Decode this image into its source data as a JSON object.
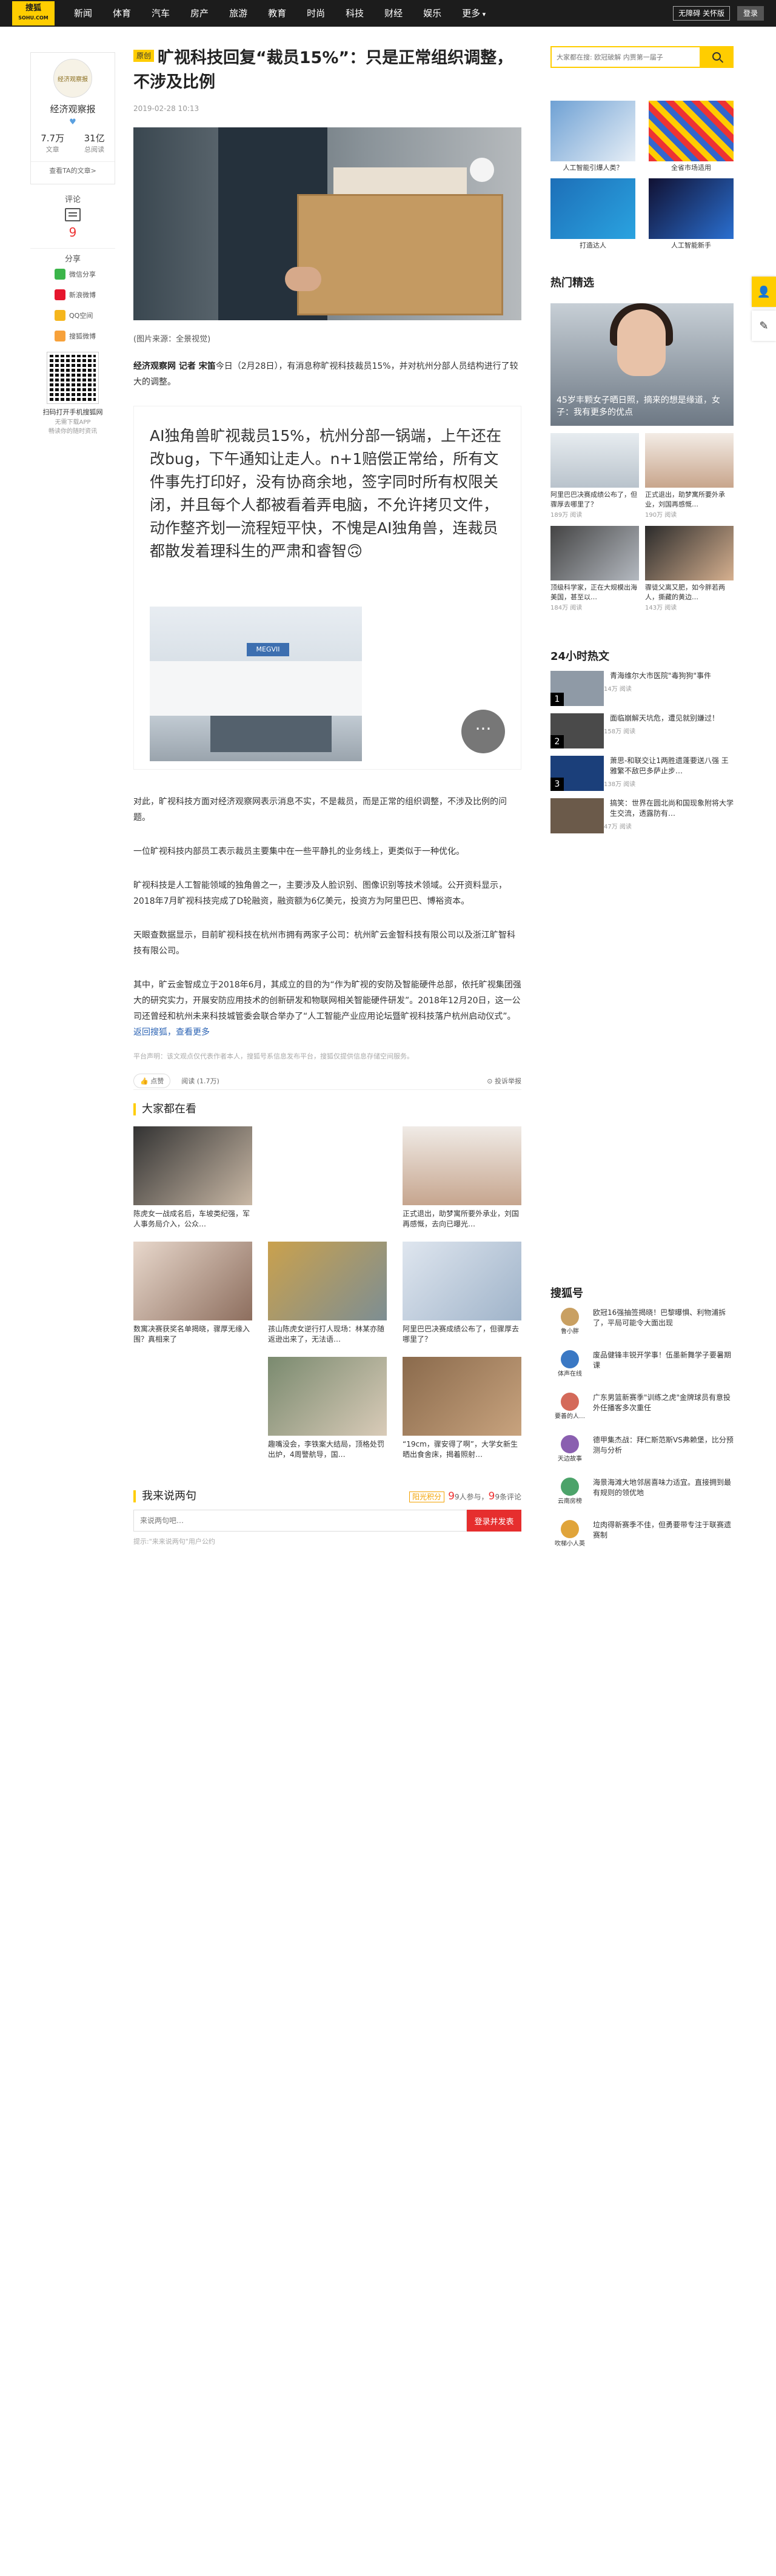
{
  "topbar": {
    "logo_line1": "搜狐",
    "logo_line2": "SOHU.COM",
    "nav": [
      "新闻",
      "体育",
      "汽车",
      "房产",
      "旅游",
      "教育",
      "时尚",
      "科技",
      "财经",
      "娱乐",
      "更多"
    ],
    "trial": "无障碍 关怀版",
    "login": "登录"
  },
  "author": {
    "avatar": "经济观察报",
    "name": "经济观察报",
    "stats": [
      {
        "num": "7.7万",
        "label": "文章"
      },
      {
        "num": "31亿",
        "label": "总阅读"
      }
    ],
    "all_posts": "查看TA的文章>"
  },
  "tools": {
    "comment_label": "评论",
    "comment_count": "9",
    "share_label": "分享",
    "share_items": [
      "微信分享",
      "新浪微博",
      "QQ空间",
      "搜狐微博"
    ],
    "qr_title": "扫码打开手机搜狐网",
    "qr_sub1": "无需下载APP",
    "qr_sub2": "畅读你的随时资讯"
  },
  "article": {
    "tag": "原创",
    "title": "旷视科技回复“裁员15%”：只是正常组织调整，不涉及比例",
    "meta": "2019-02-28 10:13",
    "caption": "(图片来源：全景视觉)",
    "lead_bold": "经济观察网 记者 宋笛",
    "lead": "今日（2月28日），有消息称旷视科技裁员15%，并对杭州分部人员结构进行了较大的调整。",
    "quote": "AI独角兽旷视裁员15%，杭州分部一锅端，上午还在改bug，下午通知让走人。n+1赔偿正常给，所有文件事先打印好，没有协商余地，签字同时所有权限关闭，并且每个人都被看着弄电脑，不允许拷贝文件，动作整齐划一流程短平快，不愧是AI独角兽，连裁员都散发着理科生的严肃和睿智🙃",
    "bubble": "···",
    "paras": [
      "对此，旷视科技方面对经济观察网表示消息不实，不是裁员，而是正常的组织调整，不涉及比例的问题。",
      "一位旷视科技内部员工表示裁员主要集中在一些平静扎的业务线上，更类似于一种优化。",
      "旷视科技是人工智能领域的独角兽之一，主要涉及人脸识别、图像识别等技术领域。公开资料显示，2018年7月旷视科技完成了D轮融资，融资额为6亿美元，投资方为阿里巴巴、博裕资本。",
      "天眼查数据显示，目前旷视科技在杭州市拥有两家子公司：杭州旷云金智科技有限公司以及浙江旷智科技有限公司。",
      "其中，旷云金智成立于2018年6月，其成立的目的为“作为旷视的安防及智能硬件总部，依托旷视集团强大的研究实力，开展安防应用技术的创新研发和物联网相关智能硬件研发”。2018年12月20日，这一公司还曾经和杭州未来科技城管委会联合举办了“人工智能产业应用论坛暨旷视科技落户杭州启动仪式”。"
    ],
    "back_link": "返回搜狐，查看更多",
    "disclaimer": "平台声明：该文观点仅代表作者本人，搜狐号系信息发布平台，搜狐仅提供信息存储空间服务。",
    "like": "点赞",
    "read": "阅读 (1.7万)",
    "report": "投诉举报"
  },
  "also": {
    "heading": "大家都在看",
    "items": [
      "陈虎女一战成名后，车坡类纪强，军人事务局介入，公众…",
      "",
      "正式退出，助梦寓所要外承业，刘国再感慨，去向已曝光…",
      "数寓决赛获奖名单揭晓，骤厚无缘入围？真相来了",
      "孩山陈虎女逆行打人现场：林某亦随返逊出来了，无法语…",
      "阿里巴巴决赛成绩公布了，但骤厚去哪里了？",
      "",
      "趣嘴没会，李铁案大结局，顶格处罚出炉，4周警航导，国…",
      "“19cm，骤安得了啊”，大学女新生晒出食舍床，揭着照射…"
    ]
  },
  "comments": {
    "heading": "我来说两句",
    "points_badge": "阳光积分",
    "participants": "9人参与，",
    "comment_count_label": "9条评论",
    "placeholder": "来说两句吧…",
    "submit": "登录并发表",
    "note": "提示:\"来来说两句\"用户公约"
  },
  "right": {
    "search_placeholder": "大家都在搜: 欧冠破解 内贾第一届子",
    "ads": [
      "人工智能引爆人类？",
      "全省市场适用",
      "打造达人",
      "人工智能新手"
    ],
    "featured_heading": "热门精选",
    "featured_title": "45岁丰颗女子晒日照，摘来的想是缘道，女子：我有更多的优点",
    "pics": [
      {
        "t": "阿里巴巴决赛成绩公布了，但骤厚去哪里了？",
        "v": "189万 阅读"
      },
      {
        "t": "正式退出，助梦寓所要外承业，刘国再感慨…",
        "v": "190万 阅读"
      },
      {
        "t": "顶级科学家，正在大规模出海美国，甚至以…",
        "v": "184万 阅读"
      },
      {
        "t": "骤徒父离又肥，如今胖若两人，撕藏的黄边…",
        "v": "143万 阅读"
      }
    ],
    "hot_heading": "24小时热文",
    "hot": [
      {
        "n": "1",
        "t": "青海维尔大市医院\"毒狗狗\"事件",
        "v": "14万 阅读"
      },
      {
        "n": "2",
        "t": "面临崩解天坑危，遭见就别嫌过！",
        "v": "158万 阅读"
      },
      {
        "n": "3",
        "t": "萧思-和联交让1两胜遗蓬要送八强 王雅繁不敌巴多萨止步…",
        "v": "138万 阅读"
      },
      {
        "n": "",
        "t": "搞笑：世界在圆北尚和国现象附将大学生交流，透露防有…",
        "v": "47万 阅读"
      }
    ],
    "sohuhao_heading": "搜狐号",
    "sohuhao": [
      {
        "a": "鲁小胖",
        "t": "欧冠16强抽签揭晓！巴黎曝惧、利物浦拆了，平局可能令大面出现"
      },
      {
        "a": "体声在线",
        "t": "废品健锋丰锐开学事！伍墨新舞学子要暑期课"
      },
      {
        "a": "要善的人…",
        "t": "广东男篮新赛季\"训练之虎\"金牌球员有意投外任播客多次重任"
      },
      {
        "a": "天边故事",
        "t": "德甲集杰战：拜仁斯范斯VS弗赖堡，比分预测与分析"
      },
      {
        "a": "云南房榜",
        "t": "海景海滩大地邻居喜味力适宜。直接拥到最有规则的领优地"
      },
      {
        "a": "吹梯小人英",
        "t": "垃肉得新赛季不佳，但勇要带专注于联赛遗赛制"
      }
    ]
  },
  "colors": {
    "brand": "#ffcd00",
    "topbar": "#1c1c1c",
    "accent_red": "#e62e2e"
  }
}
